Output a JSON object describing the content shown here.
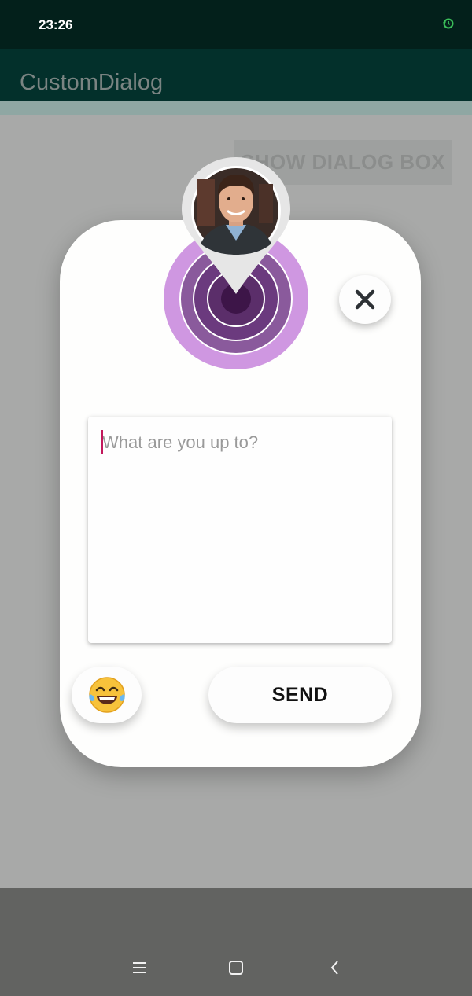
{
  "status_bar": {
    "time": "23:26",
    "sync_icon": "sync-icon"
  },
  "app_bar": {
    "title": "CustomDialog"
  },
  "main": {
    "show_dialog_label": "SHOW DIALOG BOX"
  },
  "dialog": {
    "avatar_icon": "person-avatar-icon",
    "radar_icon": "concentric-radar-icon",
    "close_icon": "close-icon",
    "message_placeholder": "What are you up to?",
    "message_value": "",
    "emoji_icon": "laughing-tears-emoji-icon",
    "send_label": "SEND",
    "colors": {
      "radar_outer": "#cf97e1",
      "radar_mid": "#8a5a9c",
      "radar_inner": "#5b2e6a",
      "radar_core": "#3d1548",
      "caret": "#c2185b"
    }
  },
  "nav_bar": {
    "menu_icon": "menu-icon",
    "home_icon": "home-square-icon",
    "back_icon": "back-chevron-icon"
  }
}
